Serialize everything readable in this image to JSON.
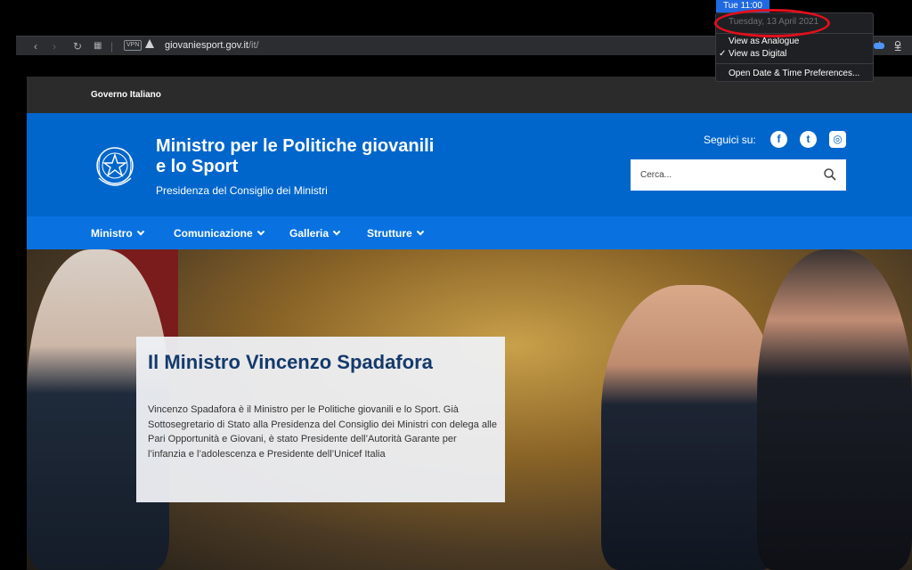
{
  "menubar": {
    "clock": "Tue 11:00"
  },
  "date_menu": {
    "date": "Tuesday, 13 April 2021",
    "items": [
      {
        "label": "View as Analogue",
        "checked": false
      },
      {
        "label": "View as Digital",
        "checked": true
      },
      {
        "label": "Open Date & Time Preferences..."
      }
    ],
    "check_mark": "✓"
  },
  "browser": {
    "vpn_badge": "VPN",
    "url_host": "giovaniesport.gov.it",
    "url_path": "/it/"
  },
  "site": {
    "gov_label": "Governo Italiano",
    "title_line1": "Ministro per le Politiche giovanili",
    "title_line2": "e lo Sport",
    "subtitle": "Presidenza del Consiglio dei Ministri",
    "follow_label": "Seguici su:",
    "social": [
      {
        "icon": "facebook-icon",
        "glyph": "f"
      },
      {
        "icon": "twitter-icon",
        "glyph": "t"
      },
      {
        "icon": "instagram-icon",
        "glyph": "◎"
      }
    ],
    "search_placeholder": "Cerca...",
    "nav": [
      "Ministro",
      "Comunicazione",
      "Galleria",
      "Strutture"
    ],
    "hero": {
      "heading": "Il Ministro Vincenzo Spadafora",
      "text": "Vincenzo Spadafora è il Ministro per le Politiche giovanili e lo Sport. Già Sottosegretario di Stato alla Presidenza del Consiglio dei Ministri con delega alle Pari Opportunità e Giovani, è stato Presidente dell’Autorità Garante per l’infanzia e l’adolescenza e Presidente dell’Unicef Italia"
    }
  },
  "colors": {
    "header_blue": "#0066cc",
    "nav_blue": "#0a72e0",
    "gov_bar": "#2b2b2b",
    "highlight_ring": "#e1101d"
  }
}
